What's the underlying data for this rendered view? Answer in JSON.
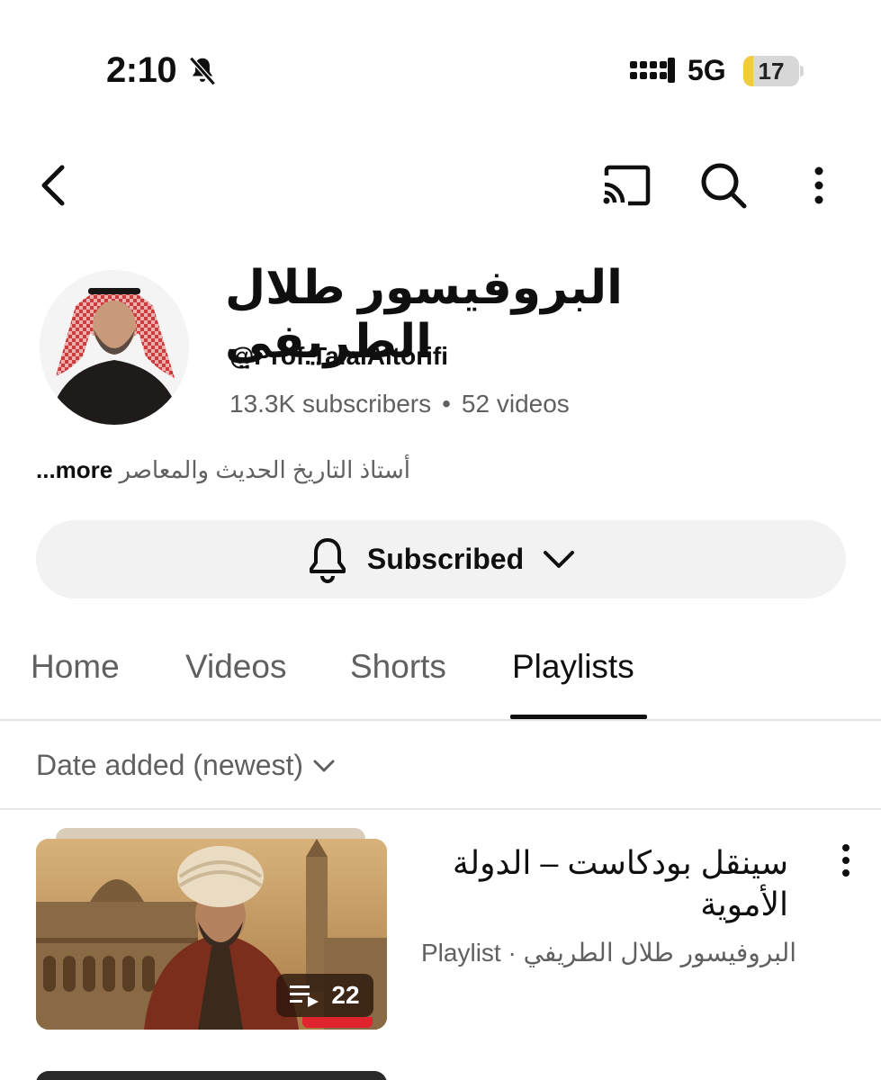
{
  "status_bar": {
    "time": "2:10",
    "network": "5G",
    "battery": "17",
    "battery_level": 0.17
  },
  "toolbar": {
    "back_icon": "chevron-left-icon",
    "cast_icon": "cast-icon",
    "search_icon": "search-icon",
    "more_icon": "more-vertical-icon"
  },
  "channel": {
    "name": "البروفيسور طلال الطريفي",
    "handle": "@Prof.TalalAltorifi",
    "subscribers": "13.3K subscribers",
    "videos": "52 videos",
    "description": "أستاذ التاريخ الحديث والمعاصر",
    "more": "...more"
  },
  "subscribe_button": {
    "label": "Subscribed"
  },
  "tabs": [
    {
      "label": "Home"
    },
    {
      "label": "Videos"
    },
    {
      "label": "Shorts"
    },
    {
      "label": "Playlists"
    }
  ],
  "active_tab": "Playlists",
  "sort": {
    "label": "Date added (newest)"
  },
  "playlists": [
    {
      "title": "سينقل بودكاست – الدولة الأموية",
      "type": "Playlist",
      "channel": "البروفيسور طلال الطريفي",
      "video_count": "22"
    }
  ],
  "colors": {
    "accent_red": "#e0242d",
    "battery_yellow": "#f2cb3a",
    "text_secondary": "#606060"
  }
}
